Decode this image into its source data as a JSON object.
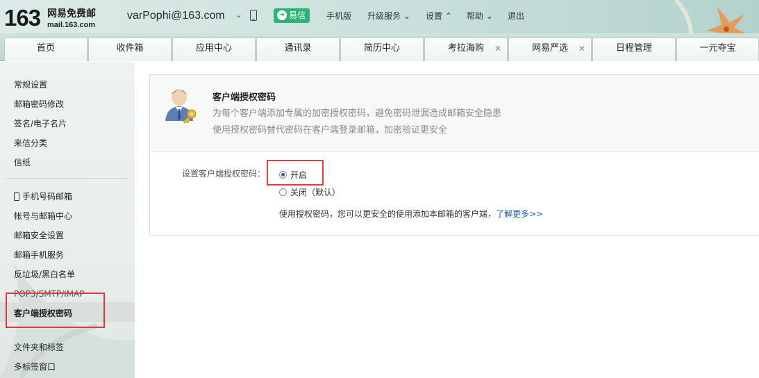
{
  "header": {
    "logo_number": "163",
    "logo_name": "网易免费邮",
    "logo_domain": "mail.163.com",
    "user_email": "varPophi@163.com",
    "yixin_label": "易信",
    "links": {
      "mobile": "手机版",
      "upgrade": "升级服务",
      "settings": "设置",
      "help": "帮助",
      "logout": "退出"
    }
  },
  "tabs": [
    {
      "label": "首页"
    },
    {
      "label": "收件箱"
    },
    {
      "label": "应用中心"
    },
    {
      "label": "通讯录"
    },
    {
      "label": "简历中心"
    },
    {
      "label": "考拉海购"
    },
    {
      "label": "网易严选"
    },
    {
      "label": "日程管理"
    },
    {
      "label": "一元夺宝"
    }
  ],
  "sidebar": {
    "group1": [
      "常规设置",
      "邮箱密码修改",
      "签名/电子名片",
      "来信分类",
      "信纸"
    ],
    "group2": [
      "手机号码邮箱",
      "帐号与邮箱中心",
      "邮箱安全设置",
      "邮箱手机服务",
      "反垃圾/黑白名单",
      "POP3/SMTP/IMAP",
      "客户端授权密码"
    ],
    "group3": [
      "文件夹和标签",
      "多标签窗口"
    ],
    "selected": "客户端授权密码"
  },
  "main": {
    "title": "客户端授权密码",
    "desc1": "为每个客户端添加专属的加密授权密码，避免密码泄漏造成邮箱安全隐患",
    "desc2": "使用授权密码替代密码在客户端登录邮箱，加密验证更安全",
    "setting_label": "设置客户端授权密码：",
    "option_on": "开启",
    "option_off": "关闭（默认）",
    "selected_option": "开启",
    "note": "使用授权密码，您可以更安全的使用添加本邮箱的客户端，",
    "learn_more": "了解更多>>"
  },
  "colors": {
    "accent_green": "#2bb379",
    "link_blue": "#1d5ea9",
    "highlight_red": "#e03a3a"
  }
}
